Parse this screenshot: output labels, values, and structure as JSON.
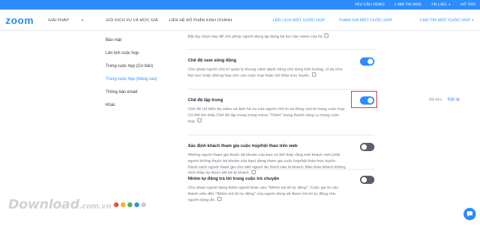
{
  "topbar": {
    "request_demo": "YÊU CẦU DEMO",
    "phone": "1.888.799.9666",
    "resources": "TÀI LIỆU",
    "support": "HỖ TRỢ"
  },
  "navbar": {
    "logo": "zoom",
    "solutions": "GIẢI PHÁP",
    "plans": "GÓI DỊCH VỤ VÀ MỨC GIÁ",
    "contact_sales": "LIÊN HỆ BỘ PHẬN KINH DOANH",
    "schedule": "LÊN LỊCH MỘT CUỘC HỌP",
    "join": "THAM GIA MỘT CUỘC HỌP",
    "host": "CHỦ TRÌ MỘT CUỘC HỌP"
  },
  "sidebar": {
    "items": [
      {
        "label": "Bảo mật"
      },
      {
        "label": "Lên lịch cuộc họp"
      },
      {
        "label": "Trong cuộc họp (Cơ bản)"
      },
      {
        "label": "Trong cuộc họp (Nâng cao)"
      },
      {
        "label": "Thông báo email"
      },
      {
        "label": "Khác"
      }
    ]
  },
  "settings": {
    "partial_top": "Bật tùy chọn này để cho phép người dùng áp dụng bộ lọc vào video của họ",
    "items": [
      {
        "title": "Chế độ xem sống động",
        "desc": "Cho phép người chủ trì quản lý khung cảnh dành riêng cho từng tình huống, ví dụ như lớp học hoặc phòng họp cho các cuộc họp hoặc hội thảo trực tuyến.",
        "enabled": true
      },
      {
        "title": "Chế độ tập trung",
        "desc": "Chế độ chỉ hiển thị video và ảnh hồ sơ của người chủ trì và đồng chủ trì trong cuộc họp. Có thể tìm thấy Chế độ tập trung trong menu \"Thêm\" trong thanh công cụ trong cuộc họp.",
        "enabled": true
      },
      {
        "title": "Xác định khách tham gia cuộc họp/hội thảo trên web",
        "desc": "Những người tham gia thuộc tài khoản của bạn có thể thấy rằng một khách mời (một người không thuộc tài khoản của bạn) đang tham gia cuộc họp/hội thảo trực tuyến. Danh sách người tham gia cho biết người dự thính nào là khách. Bản thân khách không nhìn thấy họ được liệt kê là khách.",
        "enabled": false
      },
      {
        "title": "Nhóm tự động trả lời trong cuộc trò chuyện",
        "desc": "Cho phép người dùng thêm người khác vào \"Nhóm trả lời tự động\". Cuộc gọi từ các thành viên đến \"Nhóm trả lời tự động\" của người dùng sẽ được trả lời tự động cho người dùng đó.",
        "enabled": false
      }
    ],
    "modified_label": "Đã sửa",
    "reset_label": "Đặt lại"
  },
  "watermark": {
    "text": "Download",
    "suffix": ".com.vn",
    "dot_colors": [
      "#e54d4d",
      "#f2b035",
      "#4fb05a",
      "#3a8ee6",
      "#c9cdd2"
    ]
  },
  "colors": {
    "accent": "#2d8cff",
    "highlight": "#e02828",
    "toggle_off": "#5b5f6a"
  },
  "icons": {
    "chat": "chat-bubble-icon",
    "edit": "edit-icon"
  }
}
